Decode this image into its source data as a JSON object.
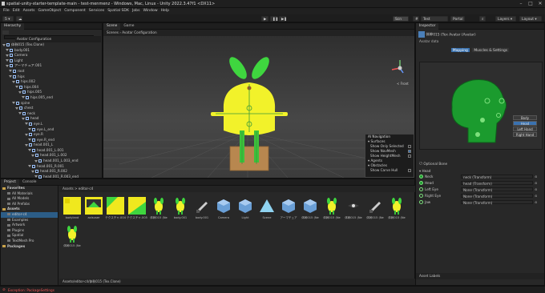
{
  "window": {
    "title": "spatial-unity-starter-template-main - test-menmenz - Windows, Mac, Linux - Unity 2022.3.47f1 <DX11>"
  },
  "menu": [
    "File",
    "Edit",
    "Assets",
    "GameObject",
    "Component",
    "Services",
    "Spatial SDK",
    "Jobs",
    "Window",
    "Help"
  ],
  "toolbar": {
    "account": "5",
    "layers": "Layers",
    "layout": "Layout",
    "cloud": "Test Package",
    "portal": "Portal",
    "scene_btn": "Scn",
    "tools": [
      "Pivot",
      "Global"
    ],
    "scene_view_mode": "2D"
  },
  "hierarchy": {
    "tab": "Hierarchy",
    "search_placeholder": "All",
    "rows": [
      {
        "text": "体幹015 (Tex.Clone)",
        "indent": 0
      },
      {
        "text": "body.001",
        "indent": 1
      },
      {
        "text": "Camera",
        "indent": 1
      },
      {
        "text": "Light",
        "indent": 1
      },
      {
        "text": "アーマチュア.001",
        "indent": 1
      },
      {
        "text": "root",
        "indent": 2
      },
      {
        "text": "hips",
        "indent": 2
      },
      {
        "text": "hips.002",
        "indent": 3
      },
      {
        "text": "hips.004",
        "indent": 4
      },
      {
        "text": "hips.005",
        "indent": 5
      },
      {
        "text": "hips.005_end",
        "indent": 6
      },
      {
        "text": "spine",
        "indent": 3
      },
      {
        "text": "chest",
        "indent": 4
      },
      {
        "text": "neck",
        "indent": 5
      },
      {
        "text": "head",
        "indent": 6
      },
      {
        "text": "eye.L",
        "indent": 7
      },
      {
        "text": "eye.L_end",
        "indent": 8
      },
      {
        "text": "eye.R",
        "indent": 7
      },
      {
        "text": "eye.R_end",
        "indent": 8
      },
      {
        "text": "head.001_L",
        "indent": 7
      },
      {
        "text": "head.001_L.001",
        "indent": 8
      },
      {
        "text": "head.001_L.002",
        "indent": 9
      },
      {
        "text": "head.001_L.003_end",
        "indent": 10
      },
      {
        "text": "head.001_R.001",
        "indent": 8
      },
      {
        "text": "head.001_R.002",
        "indent": 9
      },
      {
        "text": "head.001_R.003_end",
        "indent": 10
      },
      {
        "text": "shoulder.L",
        "indent": 5
      },
      {
        "text": "upper_arm.L",
        "indent": 6
      },
      {
        "text": "forearm.L",
        "indent": 7
      }
    ]
  },
  "scene": {
    "tabs": [
      "Scene",
      "Game"
    ],
    "breadcrumb": [
      "Scenes",
      "Avatar Configuration"
    ],
    "pivot": "Pivot",
    "global": "Global",
    "persp_label": "< Front",
    "overlay": {
      "title": "AI Navigation",
      "sections": [
        {
          "heading": "Surfaces",
          "items": [
            [
              "Show Only Selected",
              false
            ],
            [
              "Show NavMesh",
              true
            ],
            [
              "Show HeightMesh",
              false
            ]
          ]
        },
        {
          "heading": "Agents",
          "items": []
        },
        {
          "heading": "Obstacles",
          "items": [
            [
              "Show Carve Hull",
              false
            ]
          ]
        }
      ]
    }
  },
  "project": {
    "tabs": [
      "Project",
      "Console"
    ],
    "sidebar": [
      {
        "text": "Favorites",
        "bold": true,
        "indent": 0
      },
      {
        "text": "All Materials",
        "indent": 1
      },
      {
        "text": "All Models",
        "indent": 1
      },
      {
        "text": "All Prefabs",
        "indent": 1
      },
      {
        "text": "Assets",
        "bold": true,
        "indent": 0
      },
      {
        "text": "editor-c4",
        "indent": 1,
        "selected": true
      },
      {
        "text": "Examples",
        "indent": 1
      },
      {
        "text": "Artwork",
        "indent": 1
      },
      {
        "text": "Plugins",
        "indent": 1
      },
      {
        "text": "Spatial",
        "indent": 1
      },
      {
        "text": "TextMesh Pro",
        "indent": 1
      },
      {
        "text": "Packages",
        "bold": true,
        "indent": 0
      }
    ],
    "breadcrumb": "Assets > editor-c4",
    "assets": [
      {
        "label": "bodyland",
        "kind": "yellow-tex"
      },
      {
        "label": "axisuser",
        "kind": "yellow-dark"
      },
      {
        "label": "テクスチャ.004",
        "kind": "green-yellow"
      },
      {
        "label": "テクスチャ.005",
        "kind": "green-yellow2"
      },
      {
        "label": "体幹015 (Ne",
        "kind": "char"
      },
      {
        "label": "body.001",
        "kind": "char"
      },
      {
        "label": "body.001",
        "kind": "knife"
      },
      {
        "label": "Camera",
        "kind": "cube"
      },
      {
        "label": "Light",
        "kind": "cube"
      },
      {
        "label": "Scene",
        "kind": "tri"
      },
      {
        "label": "アーマチュア",
        "kind": "cube"
      },
      {
        "label": "体幹015 (Ne",
        "kind": "cube"
      },
      {
        "label": "体幹015 (Ne",
        "kind": "char"
      },
      {
        "label": "体幹015 (Ne",
        "kind": "bow"
      },
      {
        "label": "体幹015 (Ne",
        "kind": "knife"
      },
      {
        "label": "体幹015 (Ne",
        "kind": "char"
      },
      {
        "label": "体幹015 (Ne",
        "kind": "char"
      }
    ],
    "footer_path": "Assets/editor-c4/体幹015 (Tex.Clone)"
  },
  "inspector": {
    "tab": "Inspector",
    "title": "体幹015 (Tex Avatar (Avatar)",
    "subtitle": "Avatar data",
    "mode_tabs": [
      "Mapping",
      "Muscles & Settings"
    ],
    "body_buttons": [
      "Body",
      "Head",
      "Left Hand",
      "Right Hand"
    ],
    "optional_bone": "Optional Bone",
    "section": "Head",
    "bones": [
      {
        "name": "Neck",
        "value": "neck (Transform)"
      },
      {
        "name": "Head",
        "value": "head (Transform)"
      },
      {
        "name": "Left Eye",
        "value": "None (Transform)"
      },
      {
        "name": "Right Eye",
        "value": "None (Transform)"
      },
      {
        "name": "Jaw",
        "value": "None (Transform)"
      }
    ],
    "footer": "Asset Labels",
    "colors": {
      "head_green": "#1b9b2e",
      "accent": "#3a72b0"
    }
  },
  "status": {
    "error": "Exception: PackageSettings"
  }
}
